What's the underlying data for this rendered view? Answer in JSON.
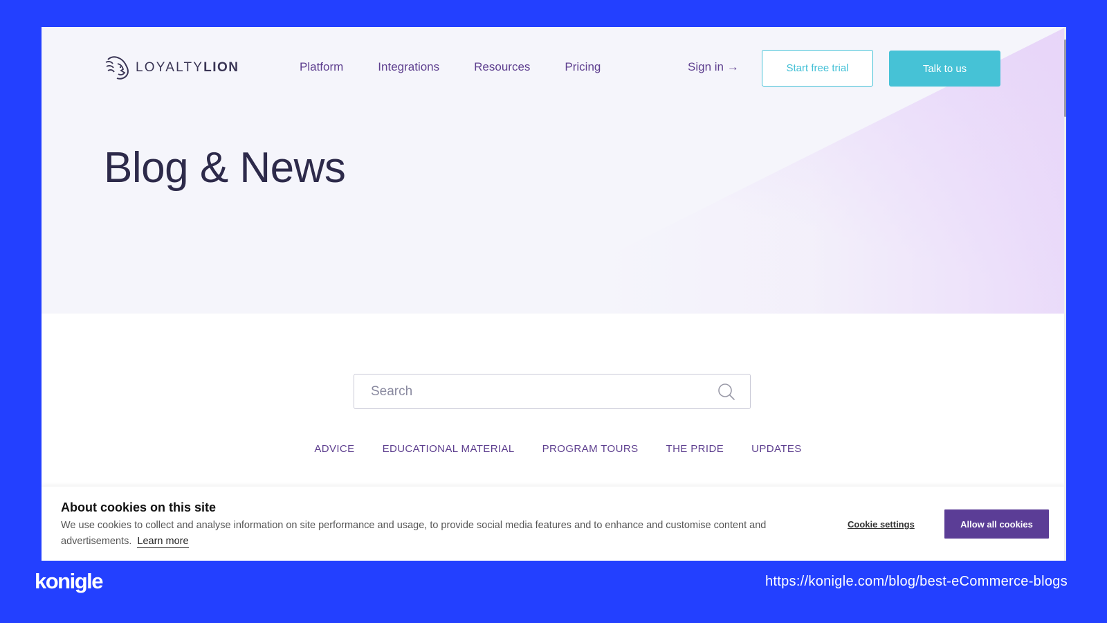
{
  "header": {
    "logo_text_light": "LOYALTY",
    "logo_text_bold": "LION",
    "nav": [
      "Platform",
      "Integrations",
      "Resources",
      "Pricing"
    ],
    "sign_in": "Sign in →",
    "start_trial": "Start free trial",
    "talk": "Talk to us"
  },
  "hero": {
    "title": "Blog & News"
  },
  "search": {
    "placeholder": "Search"
  },
  "categories": [
    "ADVICE",
    "EDUCATIONAL MATERIAL",
    "PROGRAM TOURS",
    "THE PRIDE",
    "UPDATES"
  ],
  "cookie": {
    "title": "About cookies on this site",
    "text": "We use cookies to collect and analyse information on site performance and usage, to provide social media features and to enhance and customise content and advertisements.",
    "learn_more": "Learn more",
    "settings": "Cookie settings",
    "allow": "Allow all cookies"
  },
  "footer": {
    "brand": "konigle",
    "url": "https://konigle.com/blog/best-eCommerce-blogs"
  },
  "colors": {
    "background": "#2340ff",
    "accent_teal": "#46c2d6",
    "accent_purple": "#5b3d96",
    "nav_text": "#5e3f8f"
  },
  "icons": [
    "lion-logo-icon",
    "search-icon",
    "arrow-right-icon"
  ]
}
